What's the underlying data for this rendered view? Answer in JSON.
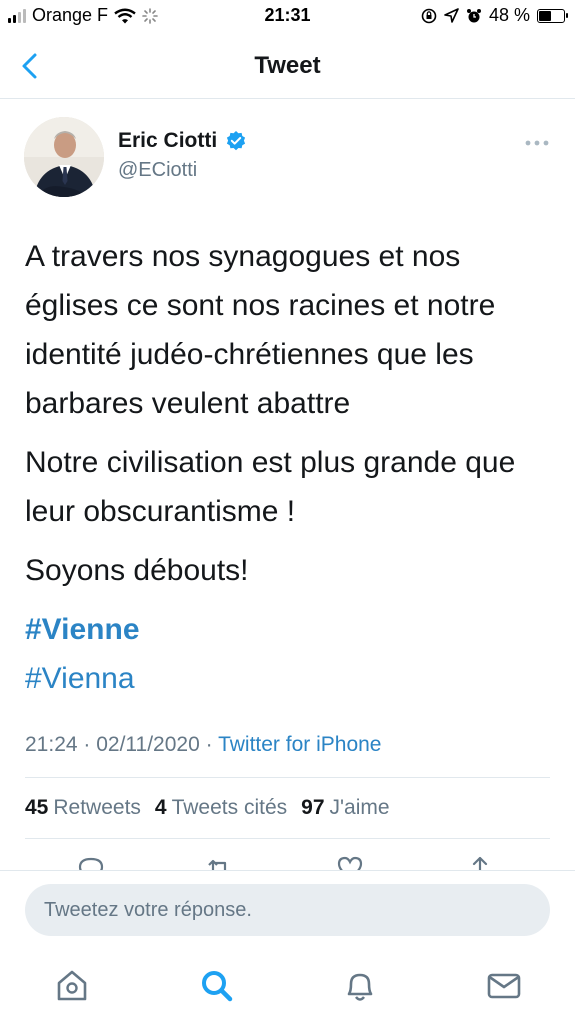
{
  "status_bar": {
    "carrier": "Orange F",
    "time": "21:31",
    "battery_percent": "48 %",
    "battery_level": 0.48
  },
  "nav": {
    "title": "Tweet",
    "back_icon": "chevron-left-icon"
  },
  "tweet": {
    "author_name": "Eric Ciotti",
    "author_handle": "@ECiotti",
    "verified": true,
    "paragraphs": [
      "A travers nos synagogues et nos églises ce sont nos racines et notre identité judéo-chrétiennes que les barbares veulent abattre",
      "Notre civilisation est plus grande que leur obscurantisme !",
      "Soyons débouts!"
    ],
    "hashtags": [
      "#Vienne",
      "#Vienna"
    ],
    "time": "21:24",
    "date": "02/11/2020",
    "source": "Twitter for iPhone",
    "stats": {
      "retweets_count": "45",
      "retweets_label": "Retweets",
      "quotes_count": "4",
      "quotes_label": "Tweets cités",
      "likes_count": "97",
      "likes_label": "J'aime"
    }
  },
  "reply": {
    "placeholder": "Tweetez votre réponse."
  },
  "tab_bar": {
    "icons": [
      "home-icon",
      "search-icon",
      "notifications-icon",
      "messages-icon"
    ]
  },
  "colors": {
    "accent": "#1da1f2",
    "link": "#2b84c5",
    "secondary_text": "#657786",
    "divider": "#e1e8ed",
    "input_bg": "#e8edf1"
  }
}
